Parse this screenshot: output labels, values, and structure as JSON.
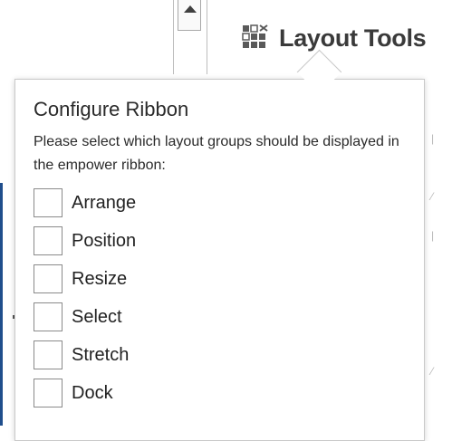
{
  "ribbon": {
    "layout_tools_label": "Layout Tools",
    "layout_tools_icon": "layout-grid-icon"
  },
  "popup": {
    "title": "Configure Ribbon",
    "description": "Please select which layout groups should be displayed in the empower ribbon:",
    "options": [
      {
        "label": "Arrange",
        "checked": false
      },
      {
        "label": "Position",
        "checked": false
      },
      {
        "label": "Resize",
        "checked": false
      },
      {
        "label": "Select",
        "checked": false
      },
      {
        "label": "Stretch",
        "checked": false
      },
      {
        "label": "Dock",
        "checked": false
      }
    ]
  },
  "colors": {
    "text": "#222222",
    "border": "#8a8a8a",
    "accent_edge": "#1f4e8c"
  }
}
